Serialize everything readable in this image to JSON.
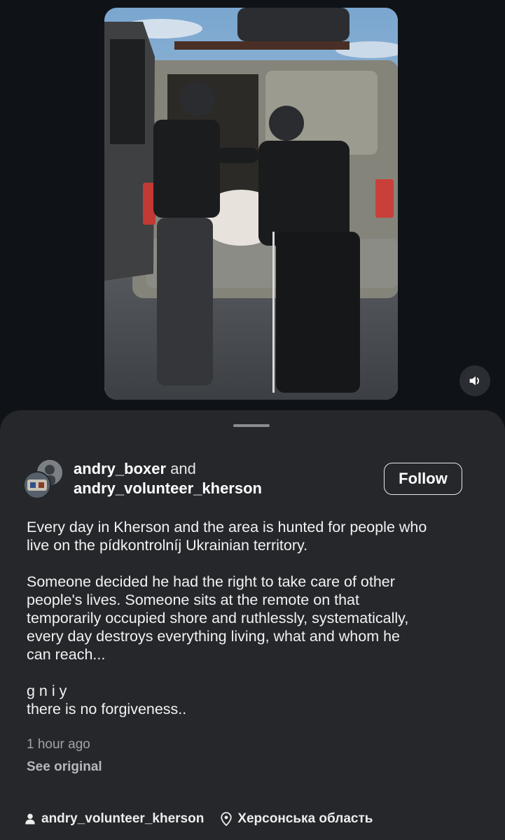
{
  "post": {
    "authors": {
      "first": "andry_boxer",
      "connector": "and",
      "second": "andry_volunteer_kherson"
    },
    "follow_label": "Follow",
    "caption": {
      "paragraph_1": [
        "Every day in Kherson and the area is hunted for people who",
        "live on the pídkontrolníj Ukrainian territory."
      ],
      "paragraph_2": [
        "Someone decided he had the right to take care of other",
        "people's lives. Someone sits at the remote on that",
        "temporarily occupied shore and ruthlessly, systematically,",
        "every day destroys everything living, what and whom he",
        "can reach..."
      ],
      "paragraph_3": [
        "g n i y",
        "there is no forgiveness.."
      ]
    },
    "timestamp": "1 hour ago",
    "see_original_label": "See original"
  },
  "footer": {
    "account": "andry_volunteer_kherson",
    "location": "Херсонська область"
  },
  "icons": {
    "mute": "volume-icon",
    "person": "person-icon",
    "location": "location-pin-icon"
  },
  "colors": {
    "background": "#0f1216",
    "sheet": "#25272b",
    "text_primary": "#ffffff",
    "text_secondary": "#a0a3a8"
  }
}
